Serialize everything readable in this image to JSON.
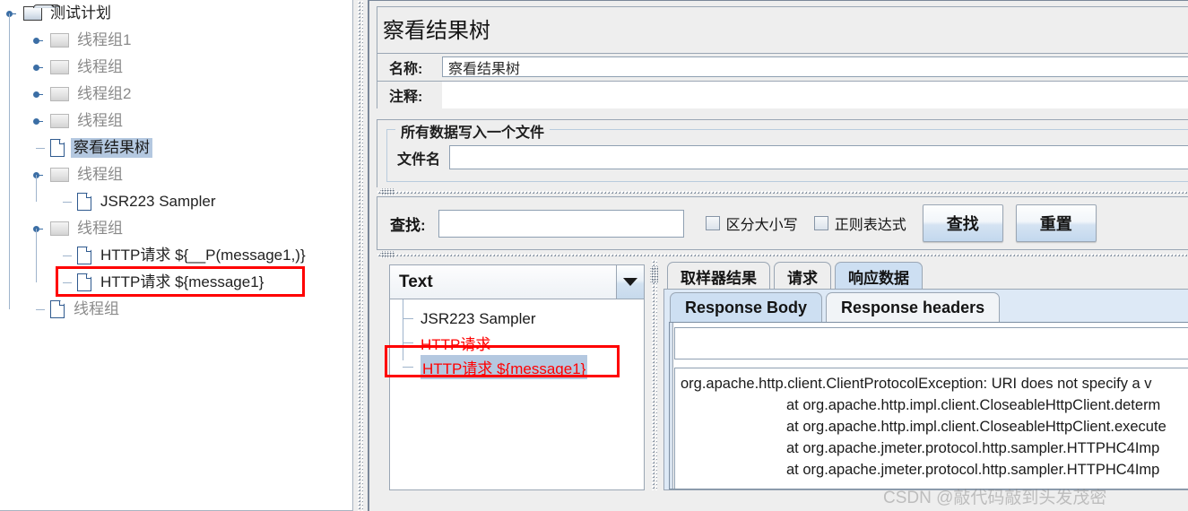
{
  "tree": {
    "nodes": [
      {
        "label": "测试计划",
        "type": "folder",
        "depth": 0,
        "expanded": true,
        "muted": false,
        "selected": false,
        "highlighted": false
      },
      {
        "label": "线程组1",
        "type": "folder",
        "depth": 1,
        "expanded": false,
        "muted": true,
        "selected": false,
        "highlighted": false
      },
      {
        "label": "线程组",
        "type": "folder",
        "depth": 1,
        "expanded": false,
        "muted": true,
        "selected": false,
        "highlighted": false
      },
      {
        "label": "线程组2",
        "type": "folder",
        "depth": 1,
        "expanded": false,
        "muted": true,
        "selected": false,
        "highlighted": false
      },
      {
        "label": "线程组",
        "type": "folder",
        "depth": 1,
        "expanded": false,
        "muted": true,
        "selected": false,
        "highlighted": false
      },
      {
        "label": "察看结果树",
        "type": "doc",
        "depth": 1,
        "expanded": null,
        "muted": false,
        "selected": true,
        "highlighted": false
      },
      {
        "label": "线程组",
        "type": "folder",
        "depth": 1,
        "expanded": true,
        "muted": true,
        "selected": false,
        "highlighted": false
      },
      {
        "label": "JSR223 Sampler",
        "type": "doc",
        "depth": 2,
        "expanded": null,
        "muted": false,
        "selected": false,
        "highlighted": false
      },
      {
        "label": "线程组",
        "type": "folder",
        "depth": 1,
        "expanded": true,
        "muted": true,
        "selected": false,
        "highlighted": false
      },
      {
        "label": "HTTP请求 ${__P(message1,)}",
        "type": "doc",
        "depth": 2,
        "expanded": null,
        "muted": false,
        "selected": false,
        "highlighted": false
      },
      {
        "label": "HTTP请求 ${message1}",
        "type": "doc",
        "depth": 2,
        "expanded": null,
        "muted": false,
        "selected": false,
        "highlighted": true
      },
      {
        "label": "线程组",
        "type": "doc",
        "depth": 1,
        "expanded": null,
        "muted": true,
        "selected": false,
        "highlighted": false
      }
    ]
  },
  "panel": {
    "title": "察看结果树",
    "name_label": "名称:",
    "name_value": "察看结果树",
    "comment_label": "注释:",
    "comment_value": "",
    "file_group_legend": "所有数据写入一个文件",
    "filename_label": "文件名",
    "filename_value": ""
  },
  "find": {
    "label": "查找:",
    "value": "",
    "case_sensitive_label": "区分大小写",
    "case_sensitive_checked": false,
    "regex_label": "正则表达式",
    "regex_checked": false,
    "search_button": "查找",
    "reset_button": "重置"
  },
  "results": {
    "render_selector_value": "Text",
    "rows": [
      {
        "label": "JSR223 Sampler",
        "color": "black",
        "selected": false,
        "highlighted": false
      },
      {
        "label": "HTTP请求",
        "color": "red",
        "selected": false,
        "highlighted": false
      },
      {
        "label": "HTTP请求 ${message1}",
        "color": "red",
        "selected": true,
        "highlighted": true
      }
    ]
  },
  "detail_tabs": {
    "items": [
      {
        "label": "取样器结果",
        "active": false
      },
      {
        "label": "请求",
        "active": false
      },
      {
        "label": "响应数据",
        "active": true
      }
    ],
    "sub_items": [
      {
        "label": "Response Body",
        "active": true
      },
      {
        "label": "Response headers",
        "active": false
      }
    ],
    "search_value": "",
    "response_lines": [
      {
        "text": "org.apache.http.client.ClientProtocolException: URI does not specify a v",
        "indent": false
      },
      {
        "text": "at org.apache.http.impl.client.CloseableHttpClient.determ",
        "indent": true
      },
      {
        "text": "at org.apache.http.impl.client.CloseableHttpClient.execute",
        "indent": true
      },
      {
        "text": "at org.apache.jmeter.protocol.http.sampler.HTTPHC4Imp",
        "indent": true
      },
      {
        "text": "at org.apache.jmeter.protocol.http.sampler.HTTPHC4Imp",
        "indent": true
      }
    ]
  },
  "watermark": {
    "text": "CSDN @敲代码敲到头发茂密"
  },
  "colors": {
    "highlight_box": "#ff0000",
    "selection": "#b4c8e0",
    "error_text": "#ff0000",
    "accent_tab": "#cddff2"
  }
}
